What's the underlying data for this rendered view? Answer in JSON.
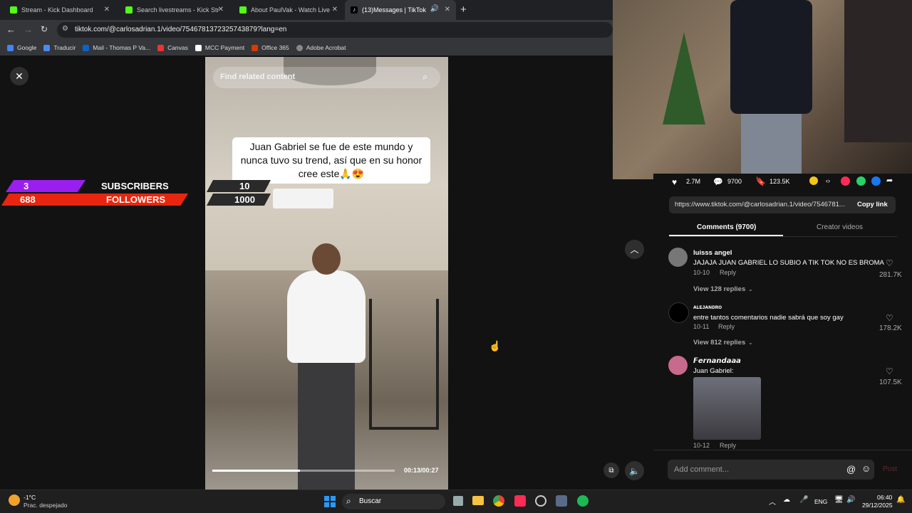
{
  "tabs": [
    {
      "label": "Stream - Kick Dashboard",
      "color": "#53fc18"
    },
    {
      "label": "Search livestreams - Kick Stream",
      "color": "#53fc18"
    },
    {
      "label": "About PaulVak - Watch Live on",
      "color": "#53fc18"
    },
    {
      "label": "(13)Messages | TikTok",
      "color": "#ffffff"
    }
  ],
  "address": "tiktok.com/@carlosadrian.1/video/7546781372325743879?lang=en",
  "bookmarks": [
    "Google",
    "Traducir",
    "Mail - Thomas P Va...",
    "Canvas",
    "MCC Payment",
    "Office 365",
    "Adobe Acrobat"
  ],
  "search_placeholder": "Find related content",
  "caption": "Juan Gabriel se fue de este mundo y nunca tuvo su trend, así que en su honor cree este🙏😍",
  "overlay": {
    "subs_count": "3",
    "subs_label": "SUBSCRIBERS",
    "subs_goal": "10",
    "followers_count": "688",
    "followers_label": "FOLLOWERS",
    "followers_goal": "1000"
  },
  "time": "00:13/00:27",
  "progress": 0.48,
  "stats": {
    "likes": "2.7M",
    "comments": "9700",
    "saves": "123.5K"
  },
  "link": {
    "url": "https://www.tiktok.com/@carlosadrian.1/video/7546781...",
    "copy": "Copy link"
  },
  "side_tabs": {
    "comments": "Comments (9700)",
    "creator": "Creator videos"
  },
  "comments": [
    {
      "user": "luisss angel",
      "text": "JAJAJA JUAN GABRIEL LO SUBIO A TIK TOK NO ES BROMA",
      "date": "10-10",
      "reply": "Reply",
      "likes": "281.7K",
      "replies": "View 128 replies"
    },
    {
      "user": "ᴀʟᴇᴊᴀɴᴅʀᴏ",
      "text": "entre tantos comentarios nadie sabrá que soy gay",
      "date": "10-11",
      "reply": "Reply",
      "likes": "178.2K",
      "replies": "View 812 replies"
    },
    {
      "user": "𝙁𝙚𝙧𝙣𝙖𝙣𝙙𝙖𝙖𝙖",
      "text": "Juan Gabriel:",
      "date": "10-12",
      "reply": "Reply",
      "likes": "107.5K",
      "replies": ""
    }
  ],
  "comment_box": {
    "placeholder": "Add comment...",
    "post": "Post"
  },
  "taskbar": {
    "weather_temp": "-1°C",
    "weather_desc": "Prac. despejado",
    "search": "Buscar",
    "lang": "ENG",
    "time": "06:40",
    "date": "29/12/2025"
  }
}
